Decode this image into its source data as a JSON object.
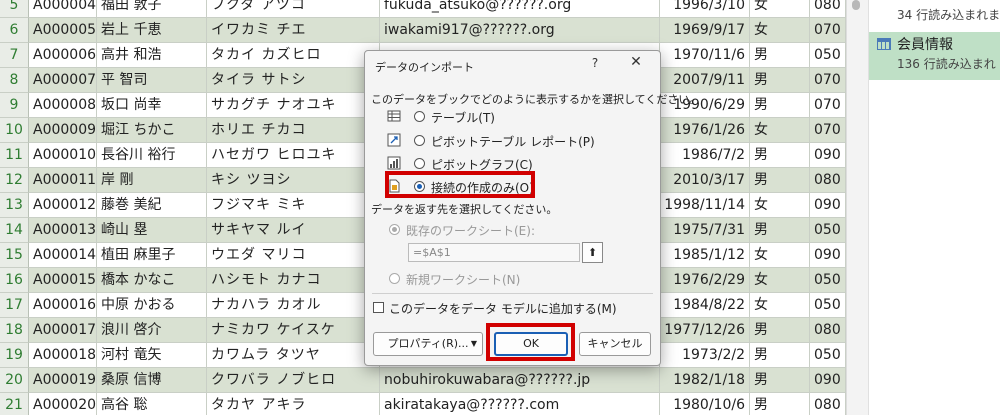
{
  "sheet": {
    "rows": [
      {
        "n": "5",
        "id": "A000004",
        "name": "福田 敦子",
        "kana": "フクダ アツコ",
        "mail": "fukuda_atsuko@??????.org",
        "bd": "1996/3/10",
        "sex": "女",
        "zip": "080"
      },
      {
        "n": "6",
        "id": "A000005",
        "name": "岩上 千恵",
        "kana": "イワカミ チエ",
        "mail": "iwakami917@??????.org",
        "bd": "1969/9/17",
        "sex": "女",
        "zip": "070"
      },
      {
        "n": "7",
        "id": "A000006",
        "name": "高井 和浩",
        "kana": "タカイ カズヒロ",
        "mail": "",
        "bd": "1970/11/6",
        "sex": "男",
        "zip": "050"
      },
      {
        "n": "8",
        "id": "A000007",
        "name": "平 智司",
        "kana": "タイラ サトシ",
        "mail": "",
        "bd": "2007/9/11",
        "sex": "男",
        "zip": "070"
      },
      {
        "n": "9",
        "id": "A000008",
        "name": "坂口 尚幸",
        "kana": "サカグチ ナオユキ",
        "mail": "",
        "bd": "1990/6/29",
        "sex": "男",
        "zip": "070"
      },
      {
        "n": "10",
        "id": "A000009",
        "name": "堀江 ちかこ",
        "kana": "ホリエ チカコ",
        "mail": "",
        "bd": "1976/1/26",
        "sex": "女",
        "zip": "070"
      },
      {
        "n": "11",
        "id": "A000010",
        "name": "長谷川 裕行",
        "kana": "ハセガワ ヒロユキ",
        "mail": "",
        "bd": "1986/7/2",
        "sex": "男",
        "zip": "090"
      },
      {
        "n": "12",
        "id": "A000011",
        "name": "岸 剛",
        "kana": "キシ ツヨシ",
        "mail": "",
        "bd": "2010/3/17",
        "sex": "男",
        "zip": "080"
      },
      {
        "n": "13",
        "id": "A000012",
        "name": "藤巻 美紀",
        "kana": "フジマキ ミキ",
        "mail": "",
        "bd": "1998/11/14",
        "sex": "女",
        "zip": "090"
      },
      {
        "n": "14",
        "id": "A000013",
        "name": "崎山 塁",
        "kana": "サキヤマ ルイ",
        "mail": "",
        "bd": "1975/7/31",
        "sex": "男",
        "zip": "050"
      },
      {
        "n": "15",
        "id": "A000014",
        "name": "植田 麻里子",
        "kana": "ウエダ マリコ",
        "mail": "",
        "bd": "1985/1/12",
        "sex": "女",
        "zip": "090"
      },
      {
        "n": "16",
        "id": "A000015",
        "name": "橋本 かなこ",
        "kana": "ハシモト カナコ",
        "mail": "",
        "bd": "1976/2/29",
        "sex": "女",
        "zip": "050"
      },
      {
        "n": "17",
        "id": "A000016",
        "name": "中原 かおる",
        "kana": "ナカハラ カオル",
        "mail": "",
        "bd": "1984/8/22",
        "sex": "女",
        "zip": "050"
      },
      {
        "n": "18",
        "id": "A000017",
        "name": "浪川 啓介",
        "kana": "ナミカワ ケイスケ",
        "mail": "",
        "bd": "1977/12/26",
        "sex": "男",
        "zip": "080"
      },
      {
        "n": "19",
        "id": "A000018",
        "name": "河村 竜矢",
        "kana": "カワムラ タツヤ",
        "mail": "",
        "bd": "1973/2/2",
        "sex": "男",
        "zip": "050"
      },
      {
        "n": "20",
        "id": "A000019",
        "name": "桑原 信博",
        "kana": "クワバラ ノブヒロ",
        "mail": "nobuhirokuwabara@??????.jp",
        "bd": "1982/1/18",
        "sex": "男",
        "zip": "090"
      },
      {
        "n": "21",
        "id": "A000020",
        "name": "高谷 聡",
        "kana": "タカヤ アキラ",
        "mail": "akiratakaya@??????.com",
        "bd": "1980/10/6",
        "sex": "男",
        "zip": "080"
      }
    ]
  },
  "queries": {
    "item1_sub": "34 行読み込まれま",
    "item2_title": "会員情報",
    "item2_sub": "136 行読み込まれ"
  },
  "dialog": {
    "title": "データのインポート",
    "help": "?",
    "close": "✕",
    "prompt1": "このデータをブックでどのように表示するかを選択してください。",
    "opt_table": "テーブル(T)",
    "opt_pivot_table": "ピボットテーブル レポート(P)",
    "opt_pivot_chart": "ピボットグラフ(C)",
    "opt_conn_only": "接続の作成のみ(O)",
    "prompt2": "データを返す先を選択してください。",
    "opt_existing": "既存のワークシート(E):",
    "cell_ref": "=$A$1",
    "ref_button": "⬆",
    "opt_new_sheet": "新規ワークシート(N)",
    "add_to_model": "このデータをデータ モデルに追加する(M)",
    "btn_properties": "プロパティ(R)...",
    "btn_ok": "OK",
    "btn_cancel": "キャンセル"
  },
  "colors": {
    "highlight": "#d10000",
    "row_alt": "#d9e1d2",
    "query_selected": "#bfe0c6"
  }
}
